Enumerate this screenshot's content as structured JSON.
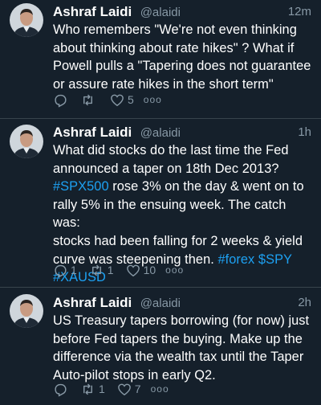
{
  "tweets": [
    {
      "name": "Ashraf Laidi",
      "handle": "@alaidi",
      "time": "12m",
      "text_lines": [
        "Who remembers \"We're not even thinking",
        "about thinking about rate hikes\" ? What if",
        "Powell pulls a \"Tapering does not guarantee",
        "or assure rate hikes in the short term\""
      ],
      "retweets": "",
      "likes": "5",
      "more": "ooo"
    },
    {
      "name": "Ashraf Laidi",
      "handle": "@alaidi",
      "time": "1h",
      "text_lines": {
        "l1": "What did stocks do the last time the Fed",
        "l2": "announced a taper on 18th Dec 2013?",
        "l3_link": "#SPX500",
        "l3_rest": " rose 3% on the day & went on to",
        "l4": "rally 5% in the ensuing week. The catch was:",
        "l5": "stocks had been falling for 2 weeks & yield",
        "l6_text": "curve was steepening then. ",
        "l6_link1": "#forex",
        "l6_space": " ",
        "l6_link2": "$SPY",
        "l7_link": "#XAUSD"
      },
      "replies": "1",
      "retweets": "1",
      "likes": "10",
      "more": "ooo"
    },
    {
      "name": "Ashraf Laidi",
      "handle": "@alaidi",
      "time": "2h",
      "text_lines": [
        "US Treasury tapers borrowing (for now) just",
        "before Fed tapers the buying. Make up the",
        "difference via the wealth tax until the Taper",
        "Auto-pilot stops in early Q2."
      ],
      "retweets": "1",
      "likes": "7",
      "more": "ooo"
    }
  ],
  "colors": {
    "background": "#15202b",
    "link": "#1da1f2",
    "secondary": "#8899a6",
    "divider": "#38444d"
  },
  "icons": [
    "reply-icon",
    "retweet-icon",
    "like-icon",
    "more-icon"
  ]
}
